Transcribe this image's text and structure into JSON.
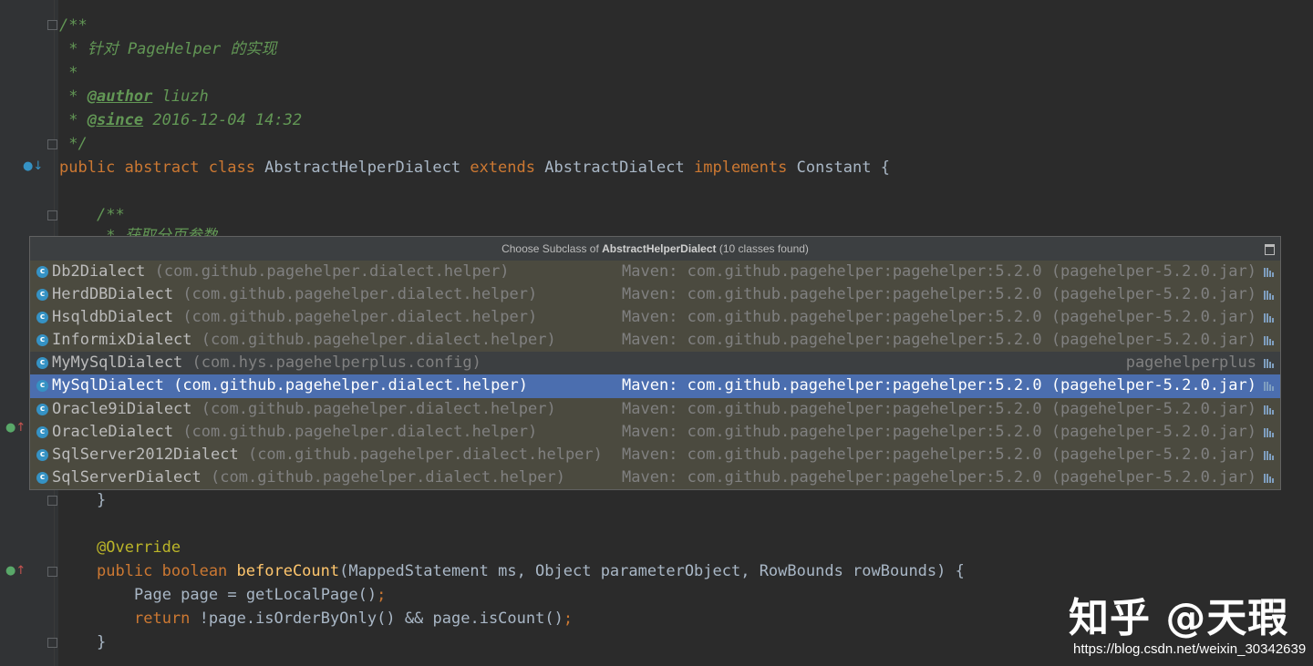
{
  "code": {
    "l1": "/**",
    "l2": " * 针对 PageHelper 的实现",
    "l3": " *",
    "l4_prefix": " * ",
    "l4_tag": "@author",
    "l4_rest": " liuzh",
    "l5_prefix": " * ",
    "l5_tag": "@since",
    "l5_rest": " 2016-12-04 14:32",
    "l6": " */",
    "class_kw": "public abstract class",
    "class_name": " AbstractHelperDialect ",
    "extends_kw": "extends",
    "super_name": " AbstractDialect ",
    "implements_kw": "implements",
    "iface_name": " Constant {",
    "doc_open": "/**",
    "doc_partial": " * 获取分页参数",
    "close_brace_1": "}",
    "override": "@Override",
    "method_kw": "public boolean ",
    "method_name": "beforeCount",
    "method_params": "(MappedStatement ms, Object parameterObject, RowBounds rowBounds) {",
    "body1_a": "Page page = getLocalPage()",
    "body1_b": ";",
    "body2_kw": "return",
    "body2_rest": " !page.isOrderByOnly() && page.isCount()",
    "body2_end": ";",
    "close_brace_2": "}"
  },
  "popup": {
    "title_prefix": "Choose Subclass of ",
    "title_class": "AbstractHelperDialect",
    "title_suffix": " (10 classes found)",
    "items": [
      {
        "name": "Db2Dialect",
        "pkg": "(com.github.pagehelper.dialect.helper)",
        "location": "Maven: com.github.pagehelper:pagehelper:5.2.0 (pagehelper-5.2.0.jar)"
      },
      {
        "name": "HerdDBDialect",
        "pkg": "(com.github.pagehelper.dialect.helper)",
        "location": "Maven: com.github.pagehelper:pagehelper:5.2.0 (pagehelper-5.2.0.jar)"
      },
      {
        "name": "HsqldbDialect",
        "pkg": "(com.github.pagehelper.dialect.helper)",
        "location": "Maven: com.github.pagehelper:pagehelper:5.2.0 (pagehelper-5.2.0.jar)"
      },
      {
        "name": "InformixDialect",
        "pkg": "(com.github.pagehelper.dialect.helper)",
        "location": "Maven: com.github.pagehelper:pagehelper:5.2.0 (pagehelper-5.2.0.jar)"
      },
      {
        "name": "MyMySqlDialect",
        "pkg": "(com.hys.pagehelperplus.config)",
        "location": "pagehelperplus"
      },
      {
        "name": "MySqlDialect",
        "pkg": "(com.github.pagehelper.dialect.helper)",
        "location": "Maven: com.github.pagehelper:pagehelper:5.2.0 (pagehelper-5.2.0.jar)"
      },
      {
        "name": "Oracle9iDialect",
        "pkg": "(com.github.pagehelper.dialect.helper)",
        "location": "Maven: com.github.pagehelper:pagehelper:5.2.0 (pagehelper-5.2.0.jar)"
      },
      {
        "name": "OracleDialect",
        "pkg": "(com.github.pagehelper.dialect.helper)",
        "location": "Maven: com.github.pagehelper:pagehelper:5.2.0 (pagehelper-5.2.0.jar)"
      },
      {
        "name": "SqlServer2012Dialect",
        "pkg": "(com.github.pagehelper.dialect.helper)",
        "location": "Maven: com.github.pagehelper:pagehelper:5.2.0 (pagehelper-5.2.0.jar)"
      },
      {
        "name": "SqlServerDialect",
        "pkg": "(com.github.pagehelper.dialect.helper)",
        "location": "Maven: com.github.pagehelper:pagehelper:5.2.0 (pagehelper-5.2.0.jar)"
      }
    ],
    "selected_index": 5,
    "local_index": 4
  },
  "watermark": {
    "brand": "知乎 @天瑕",
    "url": "https://blog.csdn.net/weixin_30342639"
  },
  "icons": {
    "class_icon_letter": "c",
    "gutter_impl": "↓",
    "gutter_override": "↑"
  },
  "colors": {
    "background": "#2b2b2b",
    "keyword": "#cc7832",
    "comment": "#629755",
    "annotation": "#bbb529",
    "method": "#ffc66d",
    "selection": "#4b6eaf"
  }
}
